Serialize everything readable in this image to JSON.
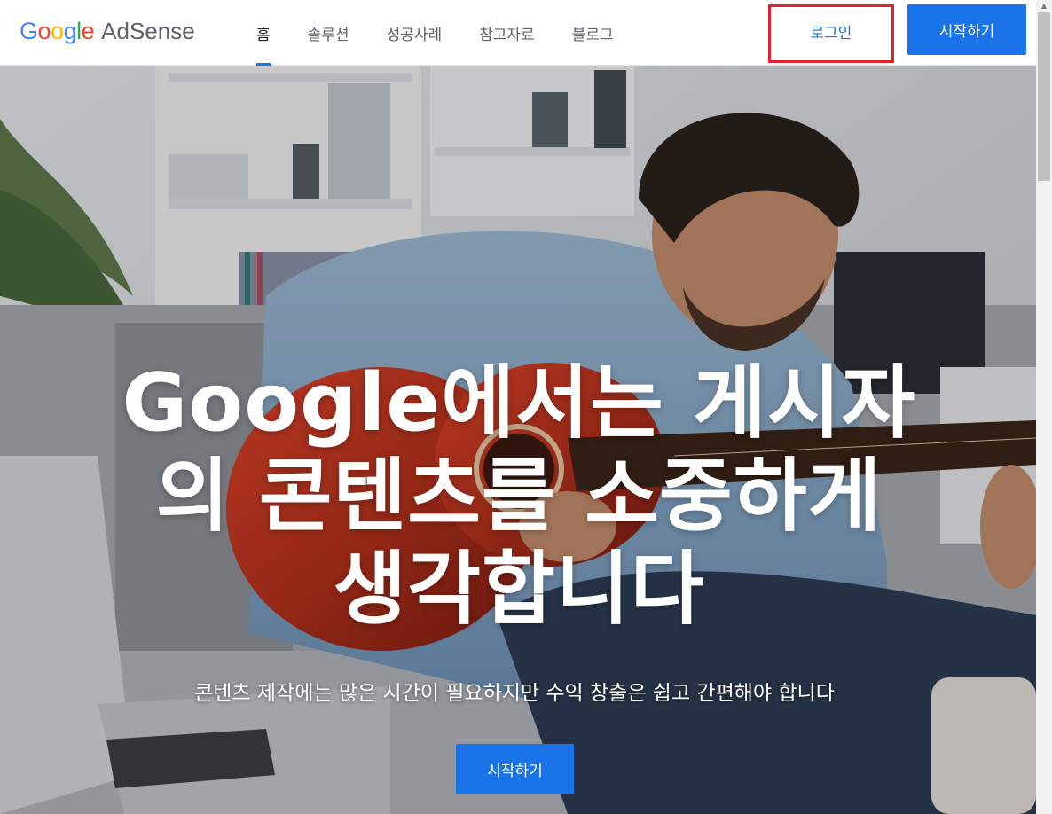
{
  "header": {
    "logo": {
      "word": "Google",
      "letters": [
        {
          "ch": "G",
          "color": "#4285F4"
        },
        {
          "ch": "o",
          "color": "#EA4335"
        },
        {
          "ch": "o",
          "color": "#FBBC05"
        },
        {
          "ch": "g",
          "color": "#4285F4"
        },
        {
          "ch": "l",
          "color": "#34A853"
        },
        {
          "ch": "e",
          "color": "#EA4335"
        }
      ],
      "product": "AdSense"
    },
    "nav": [
      "홈",
      "솔루션",
      "성공사례",
      "참고자료",
      "블로그"
    ],
    "active_nav": "홈",
    "login_label": "로그인",
    "start_label": "시작하기"
  },
  "hero": {
    "title_lines": [
      "Google에서는 게시자",
      "의 콘텐츠를 소중하게",
      "생각합니다"
    ],
    "subtitle": "콘텐츠 제작에는 많은 시간이 필요하지만 수익 창출은 쉽고 간편해야 합니다",
    "cta_label": "시작하기"
  },
  "colors": {
    "accent": "#1a73e8",
    "highlight_border": "#e0242e",
    "nav_text": "#5f6368"
  }
}
